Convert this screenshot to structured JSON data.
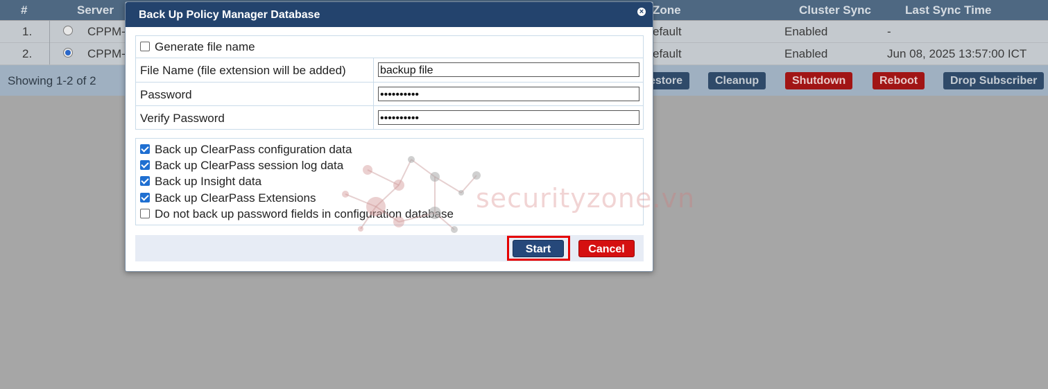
{
  "table": {
    "headers": {
      "num": "#",
      "server": "Server",
      "zone": "Zone",
      "cluster_sync": "Cluster Sync",
      "last_sync": "Last Sync Time"
    },
    "rows": [
      {
        "num": "1.",
        "server": "CPPM-",
        "zone": "efault",
        "cluster_sync": "Enabled",
        "last_sync": "-",
        "selected": false
      },
      {
        "num": "2.",
        "server": "CPPM-",
        "zone": "efault",
        "cluster_sync": "Enabled",
        "last_sync": "Jun 08, 2025 13:57:00 ICT",
        "selected": true
      }
    ],
    "showing": "Showing 1-2 of 2",
    "buttons": {
      "restore": "estore",
      "cleanup": "Cleanup",
      "shutdown": "Shutdown",
      "reboot": "Reboot",
      "drop_subscriber": "Drop Subscriber"
    }
  },
  "dialog": {
    "title": "Back Up Policy Manager Database",
    "generate_file_name": {
      "label": "Generate file name",
      "checked": false
    },
    "fields": {
      "file_name": {
        "label": "File Name (file extension will be added)",
        "value": "backup file"
      },
      "password": {
        "label": "Password",
        "value": "••••••••••"
      },
      "verify_password": {
        "label": "Verify Password",
        "value": "••••••••••"
      }
    },
    "options": [
      {
        "label": "Back up ClearPass configuration data",
        "checked": true
      },
      {
        "label": "Back up ClearPass session log data",
        "checked": true
      },
      {
        "label": "Back up Insight data",
        "checked": true
      },
      {
        "label": "Back up ClearPass Extensions",
        "checked": true
      },
      {
        "label": "Do not back up password fields in configuration database",
        "checked": false
      }
    ],
    "start_label": "Start",
    "cancel_label": "Cancel"
  },
  "watermark": "securityzone.vn"
}
